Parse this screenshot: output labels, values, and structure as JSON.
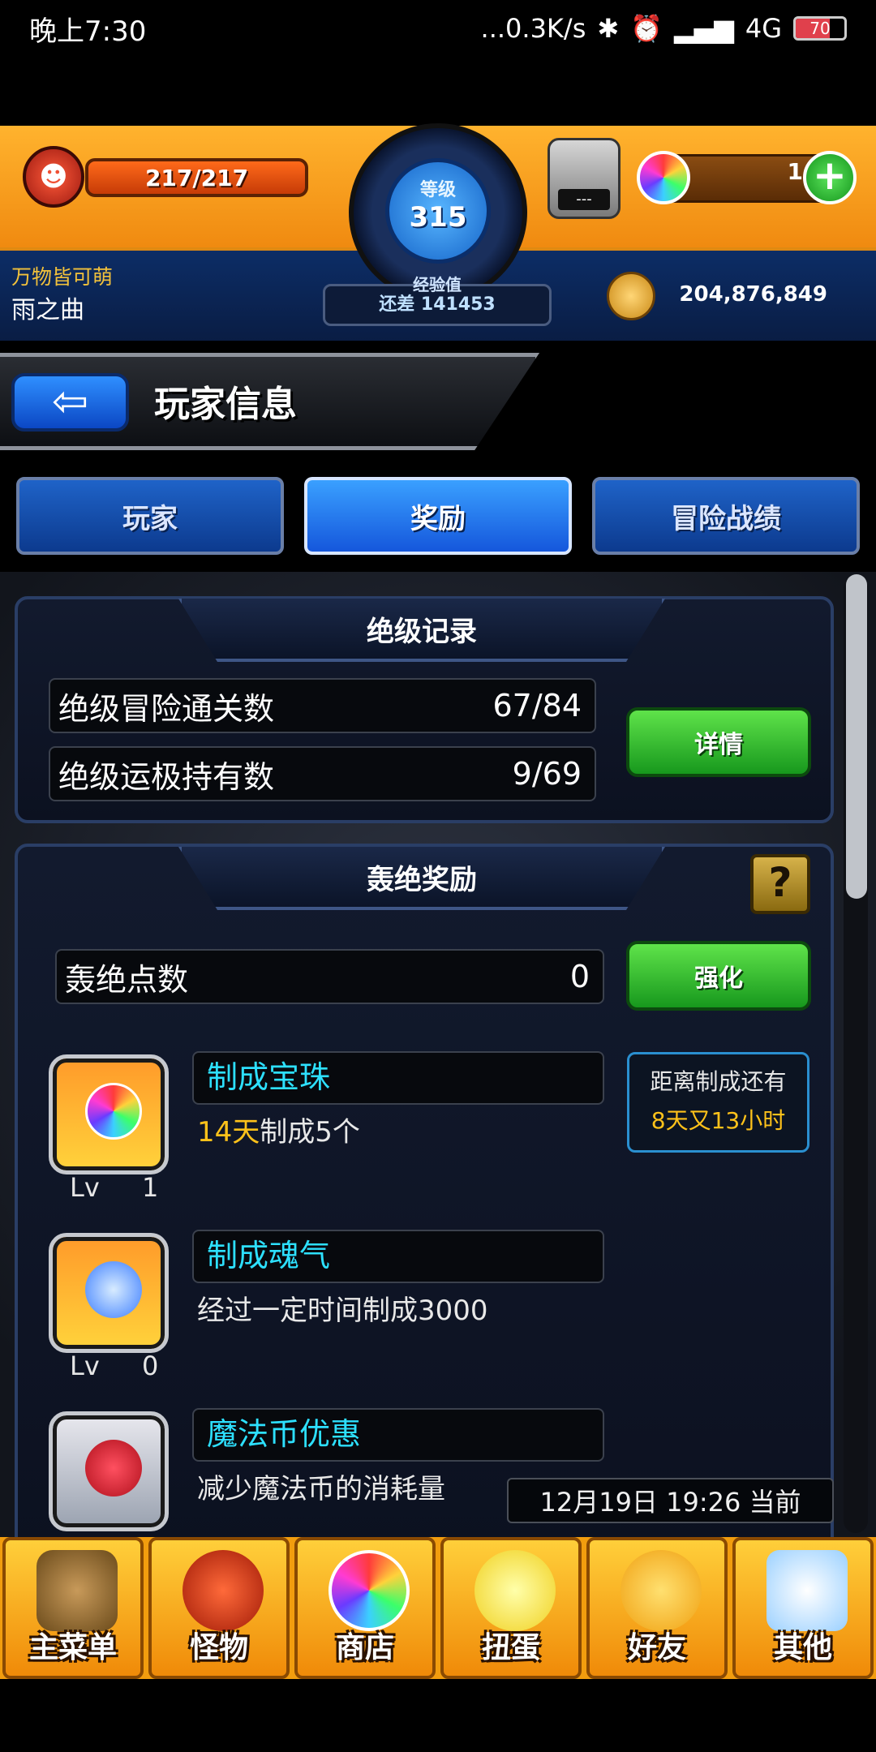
{
  "status_bar": {
    "time": "晚上7:30",
    "network": "...0.3K/s",
    "signal": "4G",
    "battery": "70",
    "battery_level": 0.7
  },
  "header": {
    "stamina": "217/217",
    "level_label": "等级",
    "level": "315",
    "exp_label": "经验值",
    "exp_remaining": "还差 141453",
    "gem_machine_slot": "---",
    "gems": "1",
    "player_title": "万物皆可萌",
    "player_name": "雨之曲",
    "coins": "204,876,849"
  },
  "titlebar": {
    "title": "玩家信息"
  },
  "tabs": [
    {
      "label": "玩家",
      "active": false
    },
    {
      "label": "奖励",
      "active": true
    },
    {
      "label": "冒险战绩",
      "active": false
    }
  ],
  "ultra_record": {
    "heading": "绝级记录",
    "rows": [
      {
        "label": "绝级冒险通关数",
        "value": "67/84"
      },
      {
        "label": "绝级运极持有数",
        "value": "9/69"
      }
    ],
    "details_button": "详情"
  },
  "ultra_reward": {
    "heading": "轰绝奖励",
    "help": "?",
    "points_label": "轰绝点数",
    "points_value": "0",
    "enhance_button": "强化",
    "items": [
      {
        "name": "制成宝珠",
        "desc_highlight": "14天",
        "desc": "制成5个",
        "lv_label": "Lv",
        "lv": "1"
      },
      {
        "name": "制成魂气",
        "desc": "经过一定时间制成3000",
        "lv_label": "Lv",
        "lv": "0"
      },
      {
        "name": "魔法币优惠",
        "desc": "减少魔法币的消耗量"
      }
    ],
    "countdown_line1": "距离制成还有",
    "countdown_line2": "8天又13小时",
    "timestamp": "12月19日 19:26 当前"
  },
  "bottom_menu": [
    {
      "label": "主菜单",
      "icon": "main-menu-icon"
    },
    {
      "label": "怪物",
      "icon": "monster-icon"
    },
    {
      "label": "商店",
      "icon": "shop-orb-icon"
    },
    {
      "label": "扭蛋",
      "icon": "gacha-egg-icon"
    },
    {
      "label": "好友",
      "icon": "friends-icon"
    },
    {
      "label": "其他",
      "icon": "other-icon"
    }
  ],
  "colors": {
    "header_orange": "#f08a10",
    "tab_active": "#3aa0ff",
    "green_button": "#17981d",
    "highlight_yellow": "#ffc21a",
    "reward_name_cyan": "#2de0ff"
  }
}
